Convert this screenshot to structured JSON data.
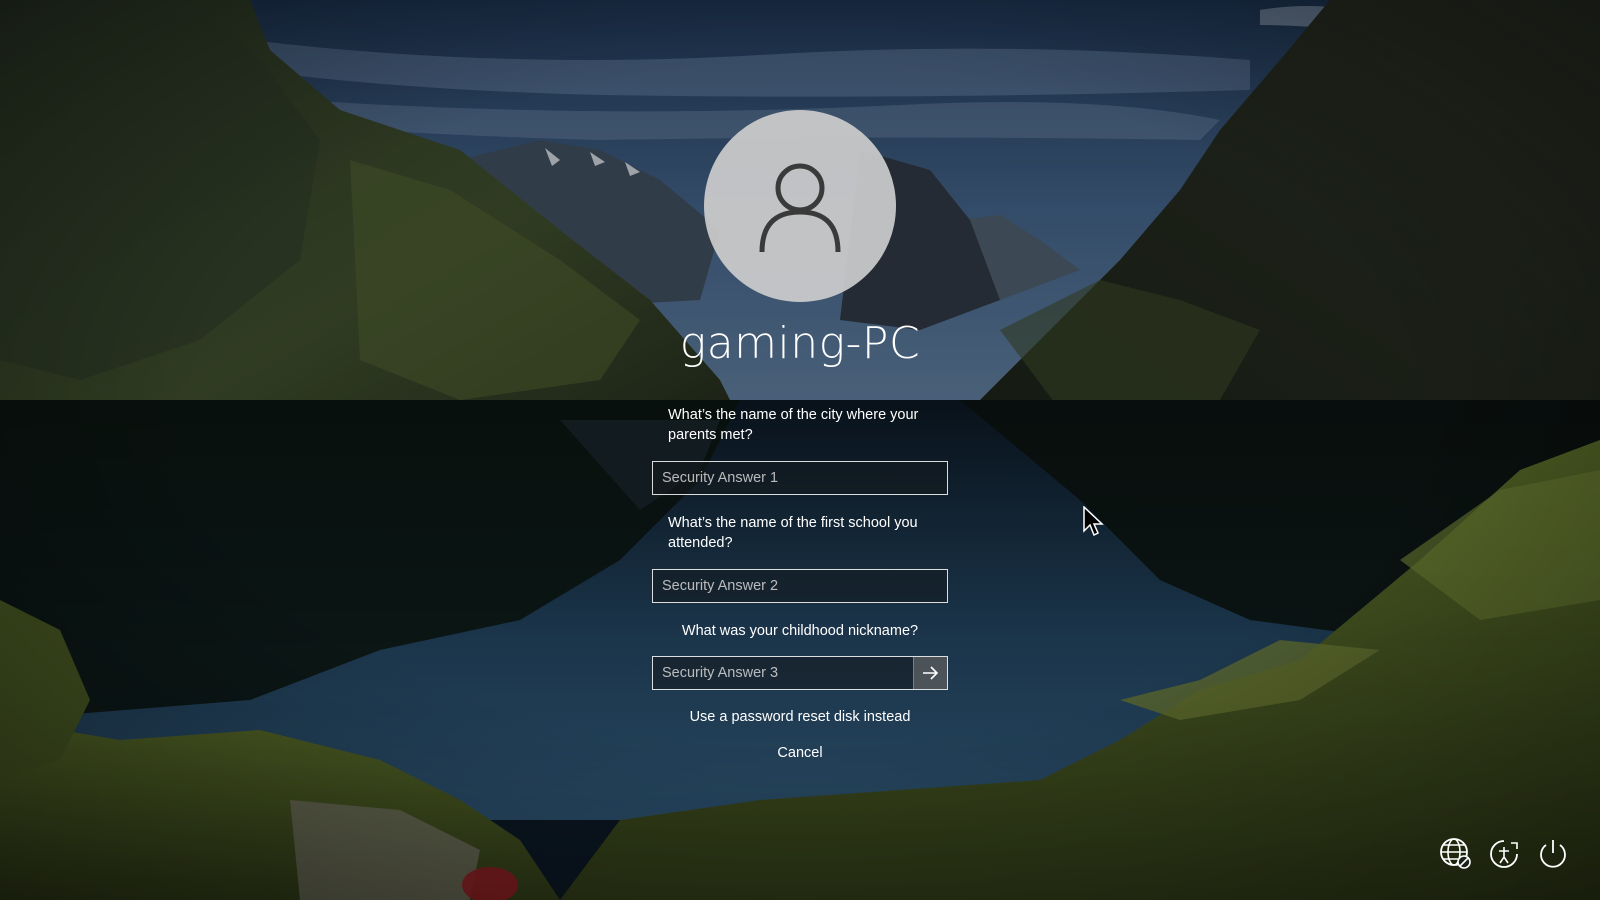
{
  "lock_screen": {
    "username": "gaming-PC",
    "questions": [
      {
        "question": "What’s the name of the city where your parents met?",
        "answer_placeholder": "Security Answer 1",
        "answer_value": ""
      },
      {
        "question": "What’s the name of the first school you attended?",
        "answer_placeholder": "Security Answer 2",
        "answer_value": ""
      },
      {
        "question": "What was your childhood nickname?",
        "answer_placeholder": "Security Answer 3",
        "answer_value": ""
      }
    ],
    "reset_disk_link": "Use a password reset disk instead",
    "cancel_link": "Cancel"
  },
  "corner_icons": [
    "network-icon",
    "ease-of-access-icon",
    "power-icon"
  ],
  "colors": {
    "text": "#ffffff",
    "avatar_bg": "#cdcdcd",
    "avatar_glyph": "#3a3a3a"
  }
}
